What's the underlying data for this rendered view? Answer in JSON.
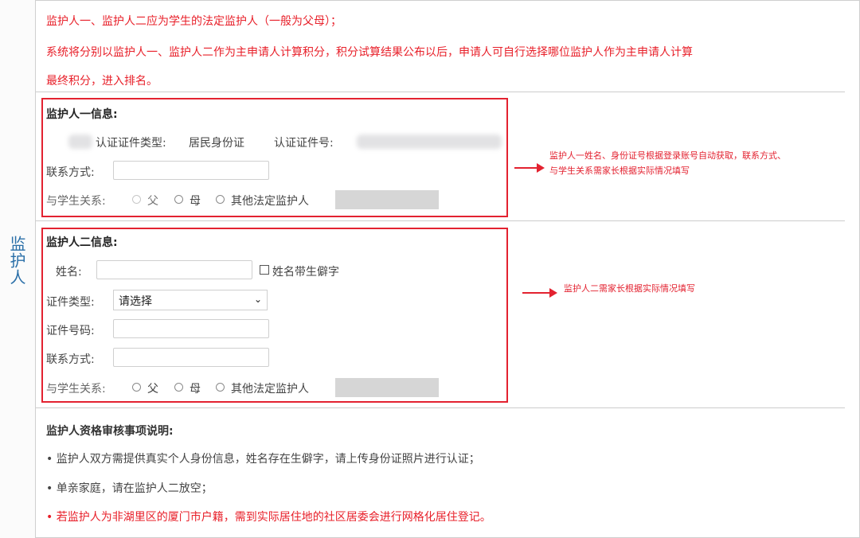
{
  "sidebar": {
    "label": "监护人"
  },
  "notice": {
    "line1": "监护人一、监护人二应为学生的法定监护人（一般为父母）；",
    "line2": "系统将分别以监护人一、监护人二作为主申请人计算积分，积分试算结果公布以后，申请人可自行选择哪位监护人作为主申请人计算",
    "line3": "最终积分，进入排名。"
  },
  "guardian1": {
    "title": "监护人一信息:",
    "id_type_label": "认证证件类型:",
    "id_type_value": "居民身份证",
    "id_no_label": "认证证件号:",
    "contact_label": "联系方式:",
    "relation_label": "与学生关系:",
    "relation_options": [
      "父",
      "母",
      "其他法定监护人"
    ]
  },
  "guardian2": {
    "title": "监护人二信息:",
    "name_label": "姓名:",
    "rare_char_label": "姓名带生僻字",
    "id_type_label": "证件类型:",
    "id_type_selected": "请选择",
    "id_no_label": "证件号码:",
    "contact_label": "联系方式:",
    "relation_label": "与学生关系:",
    "relation_options": [
      "父",
      "母",
      "其他法定监护人"
    ]
  },
  "annotations": {
    "note1_line1": "监护人一姓名、身份证号根据登录账号自动获取，联系方式、",
    "note1_line2": "与学生关系需家长根据实际情况填写",
    "note2": "监护人二需家长根据实际情况填写"
  },
  "review": {
    "title": "监护人资格审核事项说明:",
    "item1": "• 监护人双方需提供真实个人身份信息，姓名存在生僻字，请上传身份证照片进行认证；",
    "item2": "• 单亲家庭，请在监护人二放空；",
    "item3": "• 若监护人为非湖里区的厦门市户籍，需到实际居住地的社区居委会进行网格化居住登记。"
  },
  "colors": {
    "accent_red": "#e32230",
    "label_blue": "#2a6fa8"
  }
}
